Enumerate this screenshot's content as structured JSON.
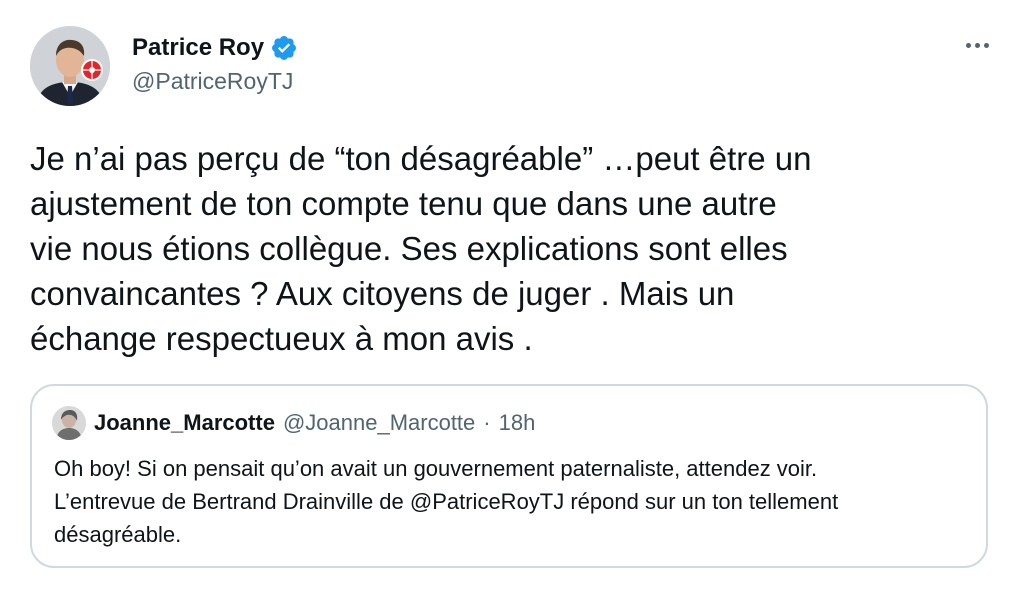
{
  "tweet": {
    "author": {
      "name": "Patrice Roy",
      "handle": "@PatriceRoyTJ",
      "verified": true
    },
    "text": "Je n’ai pas perçu de “ton désagréable” …peut être un\najustement de ton compte tenu que dans une autre\nvie nous étions collègue. Ses explications sont elles\nconvaincantes ? Aux citoyens de juger . Mais un\néchange respectueux à mon avis .",
    "quoted": {
      "name": "Joanne_Marcotte",
      "handle": "@Joanne_Marcotte",
      "separator": "·",
      "time": "18h",
      "text": "Oh boy! Si on pensait qu’on avait un gouvernement paternaliste, attendez voir.\nL’entrevue de Bertrand Drainville de @PatriceRoyTJ répond sur un ton tellement\ndésagréable."
    }
  },
  "icons": {
    "verified": "verified-badge-icon",
    "more": "more-options-icon",
    "logo": "cbc-radio-canada-logo"
  },
  "colors": {
    "verified_blue": "#1d9bf0",
    "text": "#0f1419",
    "secondary": "#536471",
    "border": "#cfd9de",
    "logo_red": "#e0262c"
  }
}
